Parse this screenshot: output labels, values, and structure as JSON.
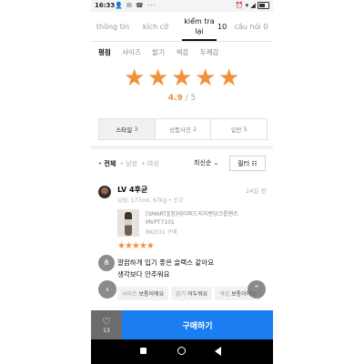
{
  "status_bar": {
    "time": "16:33",
    "left_icons": "👤 ✉ ☎ ···",
    "right_icons": "⏰ ▾ ◢"
  },
  "tabs": {
    "info": "thông tin",
    "size": "kích cỡ",
    "review": "kiểm tra lại",
    "review_count": "10",
    "qna": "câu hỏi 0"
  },
  "rating_tabs": [
    "평점",
    "사이즈",
    "밝기",
    "색감",
    "두께감"
  ],
  "rating": {
    "value": "4.9",
    "max": "/ 5",
    "stars": 5
  },
  "photo_tabs": [
    {
      "label": "스타일",
      "count": "3"
    },
    {
      "label": "상품사진",
      "count": "2"
    },
    {
      "label": "일반",
      "count": "5"
    }
  ],
  "gender_filter": {
    "all": "전체",
    "male": "남성",
    "female": "여성"
  },
  "sort": {
    "label": "최신순",
    "arrow": "⌄",
    "filter_label": "필터",
    "filter_icon": "☷"
  },
  "review": {
    "name": "LV 4후균",
    "date": "24일 전",
    "meta": "남성, 177cm, 67kg • 신고",
    "product_name": "[SMART][정]테이퍼드지지밴딩크롭팬츠 MVPT7101",
    "product_option": "BK/031 구매",
    "stars": "★★★★★",
    "text_lines": [
      "깔끔하게 입기 좋은 슬랙스 같아요",
      "생각보다 안추워요"
    ],
    "tags": [
      {
        "label": "사이즈",
        "value": "보통이에요"
      },
      {
        "label": "밝기",
        "value": "어두워요"
      },
      {
        "label": "색감",
        "value": "보통이에요"
      }
    ]
  },
  "icons": {
    "share": "share-icon",
    "prev": "chevron-left-icon",
    "top": "scroll-top-icon",
    "heart": "heart-icon"
  },
  "bottom": {
    "heart_glyph": "♡",
    "like_count": "13",
    "buy_label": "구매하기"
  },
  "colors": {
    "accent_orange": "#f2913a",
    "buy_blue": "#1a7ef2",
    "count_blue": "#1a73d9"
  }
}
